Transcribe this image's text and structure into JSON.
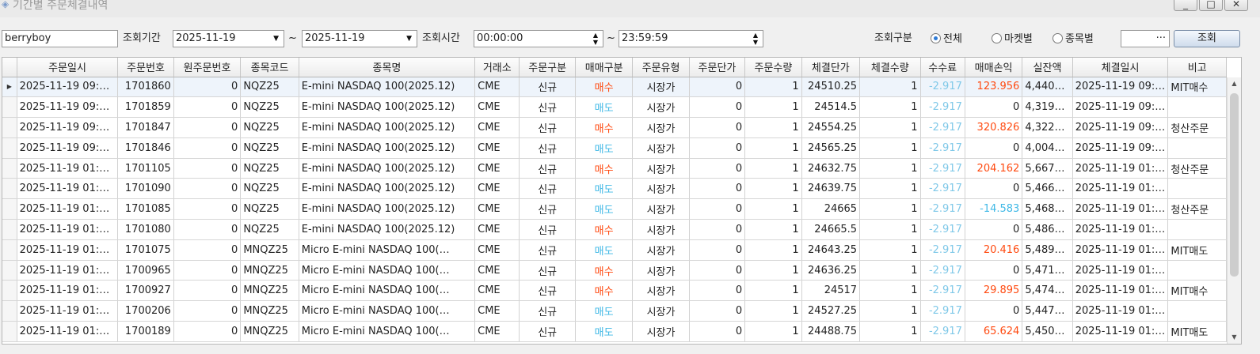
{
  "window": {
    "title": "기간별 주문체결내역",
    "minimize": "_",
    "maximize": "□",
    "close": "✕"
  },
  "toolbar": {
    "user_id": "berryboy",
    "period_label": "조회기간",
    "date_from": "2025-11-19",
    "date_to": "2025-11-19",
    "tilde": "~",
    "time_label": "조회시간",
    "time_from": "00:00:00",
    "time_to": "23:59:59",
    "filter_label": "조회구분",
    "filter_options": [
      "전체",
      "마켓별",
      "종목별"
    ],
    "filter_selected": "전체",
    "ellipsis": "···",
    "search_button": "조회"
  },
  "table": {
    "columns": [
      "주문일시",
      "주문번호",
      "원주문번호",
      "종목코드",
      "종목명",
      "거래소",
      "주문구분",
      "매매구분",
      "주문유형",
      "주문단가",
      "주문수량",
      "체결단가",
      "체결수량",
      "수수료",
      "매매손익",
      "실잔액",
      "체결일시",
      "비고"
    ],
    "rows": [
      {
        "order_time": "2025-11-19 09:…",
        "order_no": "1701860",
        "orig_no": "0",
        "code": "NQZ25",
        "name": "E-mini NASDAQ 100(2025.12)",
        "exchange": "CME",
        "order_type": "신규",
        "side": "매수",
        "price_type": "시장가",
        "order_price": "0",
        "order_qty": "1",
        "fill_price": "24510.25",
        "fill_qty": "1",
        "fee": "-2.917",
        "pnl": "123.956",
        "pnl_sign": "pos",
        "balance": "4,440…",
        "fill_time": "2025-11-19 09:…",
        "note": "MIT매수"
      },
      {
        "order_time": "2025-11-19 09:…",
        "order_no": "1701859",
        "orig_no": "0",
        "code": "NQZ25",
        "name": "E-mini NASDAQ 100(2025.12)",
        "exchange": "CME",
        "order_type": "신규",
        "side": "매도",
        "price_type": "시장가",
        "order_price": "0",
        "order_qty": "1",
        "fill_price": "24514.5",
        "fill_qty": "1",
        "fee": "-2.917",
        "pnl": "0",
        "pnl_sign": "zero",
        "balance": "4,319…",
        "fill_time": "2025-11-19 09:…",
        "note": ""
      },
      {
        "order_time": "2025-11-19 09:…",
        "order_no": "1701847",
        "orig_no": "0",
        "code": "NQZ25",
        "name": "E-mini NASDAQ 100(2025.12)",
        "exchange": "CME",
        "order_type": "신규",
        "side": "매수",
        "price_type": "시장가",
        "order_price": "0",
        "order_qty": "1",
        "fill_price": "24554.25",
        "fill_qty": "1",
        "fee": "-2.917",
        "pnl": "320.826",
        "pnl_sign": "pos",
        "balance": "4,322…",
        "fill_time": "2025-11-19 09:…",
        "note": "청산주문"
      },
      {
        "order_time": "2025-11-19 09:…",
        "order_no": "1701846",
        "orig_no": "0",
        "code": "NQZ25",
        "name": "E-mini NASDAQ 100(2025.12)",
        "exchange": "CME",
        "order_type": "신규",
        "side": "매도",
        "price_type": "시장가",
        "order_price": "0",
        "order_qty": "1",
        "fill_price": "24565.25",
        "fill_qty": "1",
        "fee": "-2.917",
        "pnl": "0",
        "pnl_sign": "zero",
        "balance": "4,004…",
        "fill_time": "2025-11-19 09:…",
        "note": ""
      },
      {
        "order_time": "2025-11-19 01:…",
        "order_no": "1701105",
        "orig_no": "0",
        "code": "NQZ25",
        "name": "E-mini NASDAQ 100(2025.12)",
        "exchange": "CME",
        "order_type": "신규",
        "side": "매수",
        "price_type": "시장가",
        "order_price": "0",
        "order_qty": "1",
        "fill_price": "24632.75",
        "fill_qty": "1",
        "fee": "-2.917",
        "pnl": "204.162",
        "pnl_sign": "pos",
        "balance": "5,667…",
        "fill_time": "2025-11-19 01:…",
        "note": "청산주문"
      },
      {
        "order_time": "2025-11-19 01:…",
        "order_no": "1701090",
        "orig_no": "0",
        "code": "NQZ25",
        "name": "E-mini NASDAQ 100(2025.12)",
        "exchange": "CME",
        "order_type": "신규",
        "side": "매도",
        "price_type": "시장가",
        "order_price": "0",
        "order_qty": "1",
        "fill_price": "24639.75",
        "fill_qty": "1",
        "fee": "-2.917",
        "pnl": "0",
        "pnl_sign": "zero",
        "balance": "5,466…",
        "fill_time": "2025-11-19 01:…",
        "note": ""
      },
      {
        "order_time": "2025-11-19 01:…",
        "order_no": "1701085",
        "orig_no": "0",
        "code": "NQZ25",
        "name": "E-mini NASDAQ 100(2025.12)",
        "exchange": "CME",
        "order_type": "신규",
        "side": "매도",
        "price_type": "시장가",
        "order_price": "0",
        "order_qty": "1",
        "fill_price": "24665",
        "fill_qty": "1",
        "fee": "-2.917",
        "pnl": "-14.583",
        "pnl_sign": "neg",
        "balance": "5,468…",
        "fill_time": "2025-11-19 01:…",
        "note": "청산주문"
      },
      {
        "order_time": "2025-11-19 01:…",
        "order_no": "1701080",
        "orig_no": "0",
        "code": "NQZ25",
        "name": "E-mini NASDAQ 100(2025.12)",
        "exchange": "CME",
        "order_type": "신규",
        "side": "매수",
        "price_type": "시장가",
        "order_price": "0",
        "order_qty": "1",
        "fill_price": "24665.5",
        "fill_qty": "1",
        "fee": "-2.917",
        "pnl": "0",
        "pnl_sign": "zero",
        "balance": "5,486…",
        "fill_time": "2025-11-19 01:…",
        "note": ""
      },
      {
        "order_time": "2025-11-19 01:…",
        "order_no": "1701075",
        "orig_no": "0",
        "code": "MNQZ25",
        "name": "Micro E-mini NASDAQ 100(…",
        "exchange": "CME",
        "order_type": "신규",
        "side": "매도",
        "price_type": "시장가",
        "order_price": "0",
        "order_qty": "1",
        "fill_price": "24643.25",
        "fill_qty": "1",
        "fee": "-2.917",
        "pnl": "20.416",
        "pnl_sign": "pos",
        "balance": "5,489…",
        "fill_time": "2025-11-19 01:…",
        "note": "MIT매도"
      },
      {
        "order_time": "2025-11-19 01:…",
        "order_no": "1700965",
        "orig_no": "0",
        "code": "MNQZ25",
        "name": "Micro E-mini NASDAQ 100(…",
        "exchange": "CME",
        "order_type": "신규",
        "side": "매수",
        "price_type": "시장가",
        "order_price": "0",
        "order_qty": "1",
        "fill_price": "24636.25",
        "fill_qty": "1",
        "fee": "-2.917",
        "pnl": "0",
        "pnl_sign": "zero",
        "balance": "5,471…",
        "fill_time": "2025-11-19 01:…",
        "note": ""
      },
      {
        "order_time": "2025-11-19 01:…",
        "order_no": "1700927",
        "orig_no": "0",
        "code": "MNQZ25",
        "name": "Micro E-mini NASDAQ 100(…",
        "exchange": "CME",
        "order_type": "신규",
        "side": "매수",
        "price_type": "시장가",
        "order_price": "0",
        "order_qty": "1",
        "fill_price": "24517",
        "fill_qty": "1",
        "fee": "-2.917",
        "pnl": "29.895",
        "pnl_sign": "pos",
        "balance": "5,474…",
        "fill_time": "2025-11-19 01:…",
        "note": "MIT매수"
      },
      {
        "order_time": "2025-11-19 01:…",
        "order_no": "1700206",
        "orig_no": "0",
        "code": "MNQZ25",
        "name": "Micro E-mini NASDAQ 100(…",
        "exchange": "CME",
        "order_type": "신규",
        "side": "매도",
        "price_type": "시장가",
        "order_price": "0",
        "order_qty": "1",
        "fill_price": "24527.25",
        "fill_qty": "1",
        "fee": "-2.917",
        "pnl": "0",
        "pnl_sign": "zero",
        "balance": "5,447…",
        "fill_time": "2025-11-19 01:…",
        "note": ""
      },
      {
        "order_time": "2025-11-19 01:…",
        "order_no": "1700189",
        "orig_no": "0",
        "code": "MNQZ25",
        "name": "Micro E-mini NASDAQ 100(…",
        "exchange": "CME",
        "order_type": "신규",
        "side": "매도",
        "price_type": "시장가",
        "order_price": "0",
        "order_qty": "1",
        "fill_price": "24488.75",
        "fill_qty": "1",
        "fee": "-2.917",
        "pnl": "65.624",
        "pnl_sign": "pos",
        "balance": "5,450…",
        "fill_time": "2025-11-19 01:…",
        "note": "MIT매도"
      }
    ]
  },
  "colors": {
    "buy": "#ff4a10",
    "sell": "#3fb8e6",
    "fee": "#7fc8e8",
    "selected_row": "#eef4fb",
    "radio_selected": "#2e7bd6"
  },
  "icons": {
    "row_pointer": "triangle-right-icon",
    "dropdown": "chevron-down-icon",
    "spinner": "spin-arrows-icon"
  }
}
